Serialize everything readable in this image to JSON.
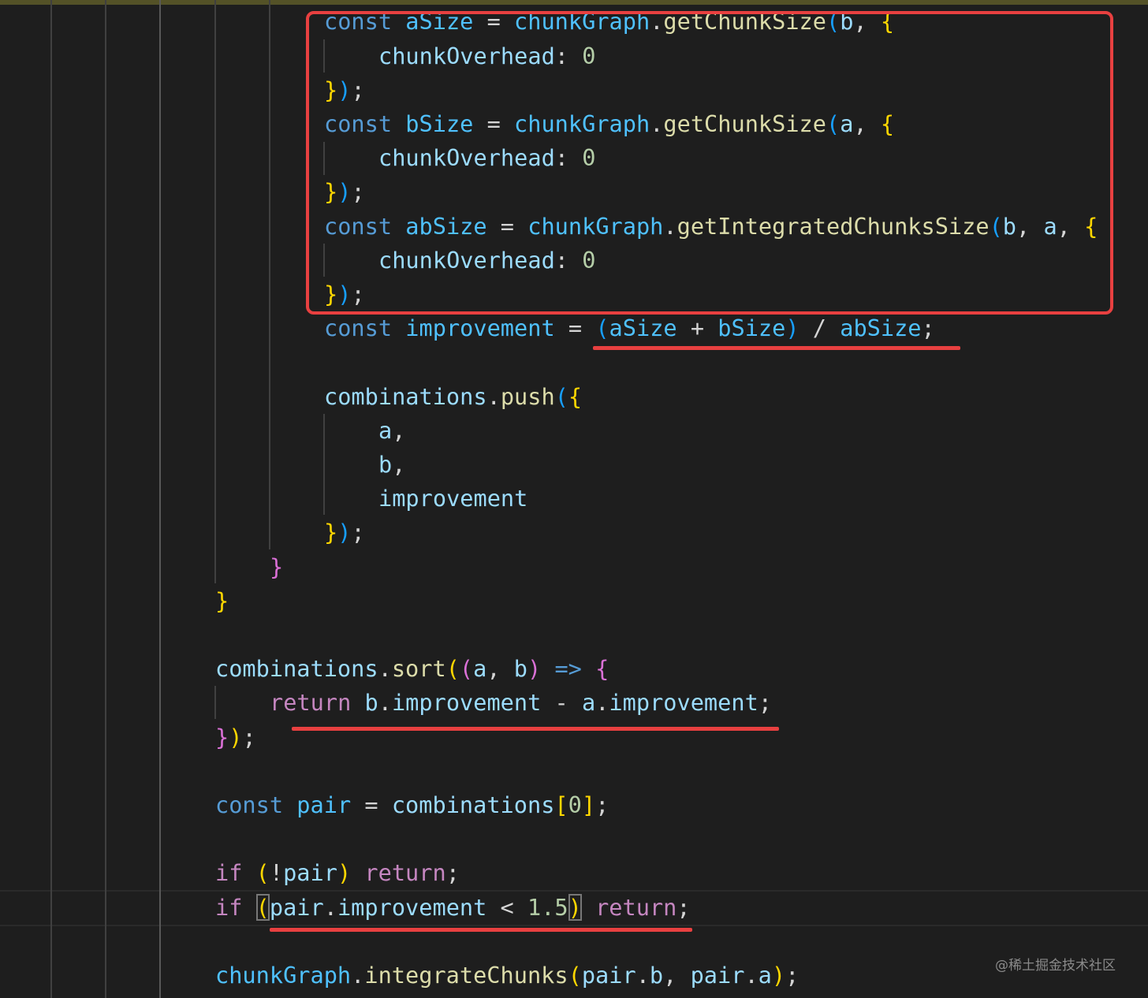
{
  "editor": {
    "lines": [
      {
        "indent": 12,
        "tokens": [
          [
            "k",
            "const"
          ],
          [
            "p",
            " "
          ],
          [
            "k2",
            "aSize"
          ],
          [
            "p",
            " = "
          ],
          [
            "k2",
            "chunkGraph"
          ],
          [
            "p",
            "."
          ],
          [
            "f",
            "getChunkSize"
          ],
          [
            "bl",
            "("
          ],
          [
            "v",
            "b"
          ],
          [
            "p",
            ", "
          ],
          [
            "g",
            "{"
          ]
        ]
      },
      {
        "indent": 16,
        "tokens": [
          [
            "v",
            "chunkOverhead"
          ],
          [
            "p",
            ": "
          ],
          [
            "n",
            "0"
          ]
        ]
      },
      {
        "indent": 12,
        "tokens": [
          [
            "g",
            "}"
          ],
          [
            "bl",
            ")"
          ],
          [
            "p",
            ";"
          ]
        ]
      },
      {
        "indent": 12,
        "tokens": [
          [
            "k",
            "const"
          ],
          [
            "p",
            " "
          ],
          [
            "k2",
            "bSize"
          ],
          [
            "p",
            " = "
          ],
          [
            "k2",
            "chunkGraph"
          ],
          [
            "p",
            "."
          ],
          [
            "f",
            "getChunkSize"
          ],
          [
            "bl",
            "("
          ],
          [
            "v",
            "a"
          ],
          [
            "p",
            ", "
          ],
          [
            "g",
            "{"
          ]
        ]
      },
      {
        "indent": 16,
        "tokens": [
          [
            "v",
            "chunkOverhead"
          ],
          [
            "p",
            ": "
          ],
          [
            "n",
            "0"
          ]
        ]
      },
      {
        "indent": 12,
        "tokens": [
          [
            "g",
            "}"
          ],
          [
            "bl",
            ")"
          ],
          [
            "p",
            ";"
          ]
        ]
      },
      {
        "indent": 12,
        "tokens": [
          [
            "k",
            "const"
          ],
          [
            "p",
            " "
          ],
          [
            "k2",
            "abSize"
          ],
          [
            "p",
            " = "
          ],
          [
            "k2",
            "chunkGraph"
          ],
          [
            "p",
            "."
          ],
          [
            "f",
            "getIntegratedChunksSize"
          ],
          [
            "bl",
            "("
          ],
          [
            "v",
            "b"
          ],
          [
            "p",
            ", "
          ],
          [
            "v",
            "a"
          ],
          [
            "p",
            ", "
          ],
          [
            "g",
            "{"
          ]
        ]
      },
      {
        "indent": 16,
        "tokens": [
          [
            "v",
            "chunkOverhead"
          ],
          [
            "p",
            ": "
          ],
          [
            "n",
            "0"
          ]
        ]
      },
      {
        "indent": 12,
        "tokens": [
          [
            "g",
            "}"
          ],
          [
            "bl",
            ")"
          ],
          [
            "p",
            ";"
          ]
        ]
      },
      {
        "indent": 12,
        "tokens": [
          [
            "k",
            "const"
          ],
          [
            "p",
            " "
          ],
          [
            "k2",
            "improvement"
          ],
          [
            "p",
            " = "
          ],
          [
            "bl",
            "("
          ],
          [
            "k2",
            "aSize"
          ],
          [
            "p",
            " + "
          ],
          [
            "k2",
            "bSize"
          ],
          [
            "bl",
            ")"
          ],
          [
            "p",
            " / "
          ],
          [
            "k2",
            "abSize"
          ],
          [
            "p",
            ";"
          ]
        ]
      },
      {
        "indent": 0,
        "tokens": []
      },
      {
        "indent": 12,
        "tokens": [
          [
            "v",
            "combinations"
          ],
          [
            "p",
            "."
          ],
          [
            "f",
            "push"
          ],
          [
            "bl",
            "("
          ],
          [
            "g",
            "{"
          ]
        ]
      },
      {
        "indent": 16,
        "tokens": [
          [
            "v",
            "a"
          ],
          [
            "p",
            ","
          ]
        ]
      },
      {
        "indent": 16,
        "tokens": [
          [
            "v",
            "b"
          ],
          [
            "p",
            ","
          ]
        ]
      },
      {
        "indent": 16,
        "tokens": [
          [
            "v",
            "improvement"
          ]
        ]
      },
      {
        "indent": 12,
        "tokens": [
          [
            "g",
            "}"
          ],
          [
            "bl",
            ")"
          ],
          [
            "p",
            ";"
          ]
        ]
      },
      {
        "indent": 8,
        "tokens": [
          [
            "pk",
            "}"
          ]
        ]
      },
      {
        "indent": 4,
        "tokens": [
          [
            "g",
            "}"
          ]
        ]
      },
      {
        "indent": 0,
        "tokens": []
      },
      {
        "indent": 4,
        "tokens": [
          [
            "v",
            "combinations"
          ],
          [
            "p",
            "."
          ],
          [
            "f",
            "sort"
          ],
          [
            "g",
            "("
          ],
          [
            "pk",
            "("
          ],
          [
            "v",
            "a"
          ],
          [
            "p",
            ", "
          ],
          [
            "v",
            "b"
          ],
          [
            "pk",
            ")"
          ],
          [
            "p",
            " "
          ],
          [
            "k",
            "=>"
          ],
          [
            "p",
            " "
          ],
          [
            "pk",
            "{"
          ]
        ]
      },
      {
        "indent": 8,
        "tokens": [
          [
            "c",
            "return"
          ],
          [
            "p",
            " "
          ],
          [
            "v",
            "b"
          ],
          [
            "p",
            "."
          ],
          [
            "v",
            "improvement"
          ],
          [
            "p",
            " - "
          ],
          [
            "v",
            "a"
          ],
          [
            "p",
            "."
          ],
          [
            "v",
            "improvement"
          ],
          [
            "p",
            ";"
          ]
        ]
      },
      {
        "indent": 4,
        "tokens": [
          [
            "pk",
            "}"
          ],
          [
            "g",
            ")"
          ],
          [
            "p",
            ";"
          ]
        ]
      },
      {
        "indent": 0,
        "tokens": []
      },
      {
        "indent": 4,
        "tokens": [
          [
            "k",
            "const"
          ],
          [
            "p",
            " "
          ],
          [
            "k2",
            "pair"
          ],
          [
            "p",
            " = "
          ],
          [
            "v",
            "combinations"
          ],
          [
            "g",
            "["
          ],
          [
            "n",
            "0"
          ],
          [
            "g",
            "]"
          ],
          [
            "p",
            ";"
          ]
        ]
      },
      {
        "indent": 0,
        "tokens": []
      },
      {
        "indent": 4,
        "tokens": [
          [
            "c",
            "if"
          ],
          [
            "p",
            " "
          ],
          [
            "g",
            "("
          ],
          [
            "p",
            "!"
          ],
          [
            "v",
            "pair"
          ],
          [
            "g",
            ")"
          ],
          [
            "p",
            " "
          ],
          [
            "c",
            "return"
          ],
          [
            "p",
            ";"
          ]
        ]
      },
      {
        "indent": 4,
        "tokens": [
          [
            "c",
            "if"
          ],
          [
            "p",
            " "
          ],
          [
            "g bm",
            "("
          ],
          [
            "v",
            "pair"
          ],
          [
            "p",
            "."
          ],
          [
            "v",
            "improvement"
          ],
          [
            "p",
            " < "
          ],
          [
            "n",
            "1.5"
          ],
          [
            "g bm",
            ")"
          ],
          [
            "p",
            " "
          ],
          [
            "c",
            "return"
          ],
          [
            "p",
            ";"
          ]
        ]
      },
      {
        "indent": 0,
        "tokens": []
      },
      {
        "indent": 4,
        "tokens": [
          [
            "k2",
            "chunkGraph"
          ],
          [
            "p",
            "."
          ],
          [
            "f",
            "integrateChunks"
          ],
          [
            "g",
            "("
          ],
          [
            "v",
            "pair"
          ],
          [
            "p",
            "."
          ],
          [
            "v",
            "b"
          ],
          [
            "p",
            ", "
          ],
          [
            "v",
            "pair"
          ],
          [
            "p",
            "."
          ],
          [
            "v",
            "a"
          ],
          [
            "g",
            ")"
          ],
          [
            "p",
            ";"
          ]
        ]
      }
    ]
  },
  "watermark": "@稀土掘金技术社区",
  "colors": {
    "background": "#1e1e1e",
    "annotation": "#e84040"
  }
}
